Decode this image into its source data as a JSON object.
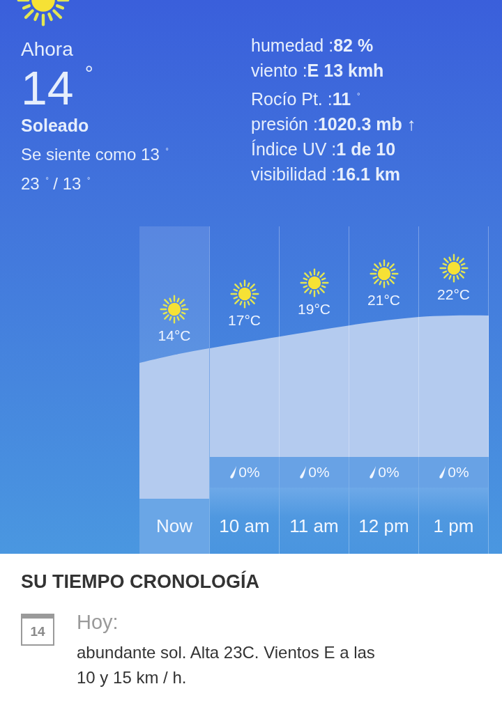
{
  "current": {
    "label": "Ahora",
    "temp": "14",
    "unit": "°",
    "condition": "Soleado",
    "feels_like": "Se siente como 13 $^{°}$",
    "range": "23 $^{°}$ / 13 $^{°}$"
  },
  "details": [
    {
      "text": "humedad :**82 %**"
    },
    {
      "text": "viento :**E 13 kmh**"
    },
    {
      "text": "Rocío Pt. :**11** $^{°}$"
    },
    {
      "text": "presión :**1020.3 mb ↑**"
    },
    {
      "text": "Índice UV :**1 de 10**"
    },
    {
      "text": "visibilidad :**16.1 km**"
    }
  ],
  "hourly": [
    {
      "time": "Now",
      "temp": "14°C",
      "selected": true
    },
    {
      "time": "10 am",
      "temp": "17°C",
      "precip": "0%",
      "selected": false
    },
    {
      "time": "11 am",
      "temp": "19°C",
      "precip": "0%",
      "selected": false
    },
    {
      "time": "12 pm",
      "temp": "21°C",
      "precip": "0%",
      "selected": false
    },
    {
      "time": "1 pm",
      "temp": "22°C",
      "precip": "0%",
      "selected": false
    }
  ],
  "timeline": {
    "title": "SU TIEMPO CRONOLOGÍA",
    "entries": [
      {
        "date": "14",
        "day": "Hoy:",
        "text": "abundante sol. Alta 23C. Vientos E a las 10 y 15 km / h."
      }
    ]
  }
}
